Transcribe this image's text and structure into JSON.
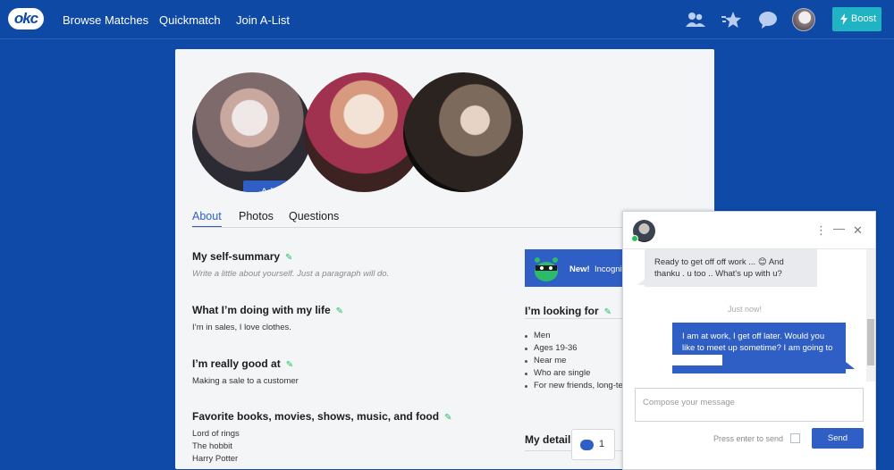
{
  "nav": {
    "logo": "okc",
    "links": [
      "Browse Matches",
      "Quickmatch",
      "Join A-List"
    ],
    "boost": "Boost",
    "icons": [
      "people-icon",
      "star-icon",
      "chat-icon"
    ]
  },
  "profile": {
    "add_label": "Add",
    "tabs": [
      "About",
      "Photos",
      "Questions"
    ],
    "sections": [
      {
        "heading": "My self-summary",
        "body": "Write a little about yourself. Just a paragraph will do.",
        "placeholder": true
      },
      {
        "heading": "What I’m doing with my life",
        "body": "I’m in sales, I love clothes."
      },
      {
        "heading": "I’m really good at",
        "body": "Making a sale to a customer"
      },
      {
        "heading": "Favorite books, movies, shows, music, and food",
        "body_lines": [
          "Lord of rings",
          "The hobbit",
          "Harry Potter"
        ]
      }
    ],
    "incognito": {
      "new_label": "New!",
      "text": "Incognito"
    },
    "looking_for": {
      "heading": "I’m looking for",
      "items": [
        "Men",
        "Ages 19-36",
        "Near me",
        "Who are single",
        "For new friends, long-term dating"
      ]
    },
    "details_heading": "My details",
    "messages_count": "1"
  },
  "chat": {
    "messages": [
      {
        "from": "them",
        "text": "Ready to get off off work ... 😊 And thanku . u too .. What's up with u?"
      },
      {
        "from": "me",
        "text": "I am at work, I get off later. Would you like to meet up sometime? I am going to this week"
      }
    ],
    "timestamp": "Just now!",
    "compose_placeholder": "Compose your message",
    "press_enter": "Press enter to send",
    "send": "Send"
  },
  "colors": {
    "nav": "#0e49a6",
    "accent": "#2f5ec4",
    "boost": "#1fb3c4",
    "online": "#29c25a"
  }
}
